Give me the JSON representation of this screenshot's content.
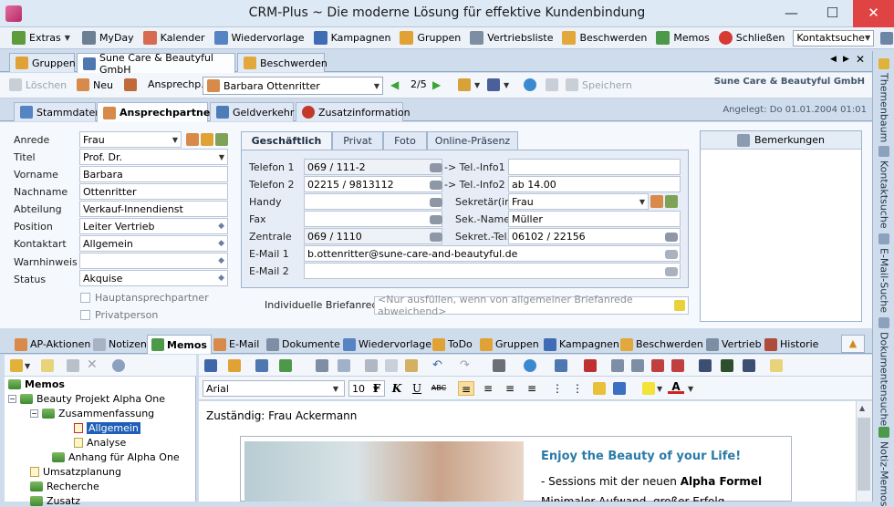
{
  "window": {
    "title": "CRM-Plus ~ Die moderne Lösung für effektive Kundenbindung"
  },
  "menu": {
    "items": [
      "Extras",
      "MyDay",
      "Kalender",
      "Wiedervorlage",
      "Kampagnen",
      "Gruppen",
      "Vertriebsliste",
      "Beschwerden",
      "Memos",
      "Schließen"
    ],
    "search_label": "Kontaktsuche"
  },
  "doc_tabs": [
    "Gruppen",
    "Sune Care & Beautyful GmbH",
    "Beschwerden"
  ],
  "toolbar": {
    "loeschen": "Löschen",
    "neu": "Neu",
    "ansprechp_label": "Ansprechp.:",
    "person": "Barbara Ottenritter",
    "pager": "2/5",
    "speichern": "Speichern",
    "company": "Sune Care & Beautyful GmbH"
  },
  "main_tabs": [
    "Stammdaten",
    "Ansprechpartner",
    "Geldverkehr",
    "Zusatzinformation"
  ],
  "angelegt": "Angelegt:  Do 01.01.2004 01:01",
  "form": {
    "anrede_label": "Anrede",
    "anrede": "Frau",
    "titel_label": "Titel",
    "titel": "Prof. Dr.",
    "vorname_label": "Vorname",
    "vorname": "Barbara",
    "nachname_label": "Nachname",
    "nachname": "Ottenritter",
    "abteilung_label": "Abteilung",
    "abteilung": "Verkauf-Innendienst",
    "position_label": "Position",
    "position": "Leiter Vertrieb",
    "kontaktart_label": "Kontaktart",
    "kontaktart": "Allgemein",
    "warnhinweis_label": "Warnhinweis",
    "warnhinweis": "",
    "status_label": "Status",
    "status": "Akquise",
    "haupt": "Hauptansprechpartner",
    "privat": "Privatperson"
  },
  "phone_tabs": [
    "Geschäftlich",
    "Privat",
    "Foto",
    "Online-Präsenz"
  ],
  "phone": {
    "tel1_label": "Telefon 1",
    "tel1": "069 / 111-2",
    "tel2_label": "Telefon 2",
    "tel2": "02215 / 9813112",
    "handy_label": "Handy",
    "handy": "",
    "fax_label": "Fax",
    "fax": "",
    "zentrale_label": "Zentrale",
    "zentrale": "069 / 1110",
    "email1_label": "E-Mail 1",
    "email1": "b.ottenritter@sune-care-and-beautyful.de",
    "email2_label": "E-Mail 2",
    "email2": "",
    "info1_label": "-> Tel.-Info1",
    "info1": "",
    "info2_label": "-> Tel.-Info2",
    "info2": "ab 14.00",
    "sekretaer_label": "Sekretär(in)",
    "sekretaer": "Frau",
    "seknamen_label": "Sek.-Name",
    "seknamen": "Müller",
    "sektel_label": "Sekret.-Tel.",
    "sektel": "06102 / 22156"
  },
  "briefanrede": {
    "label": "Individuelle Briefanrede",
    "placeholder": "<Nur ausfüllen, wenn von allgemeiner Briefanrede abweichend>"
  },
  "bemerkungen": "Bemerkungen",
  "lower_tabs": [
    "AP-Aktionen",
    "Notizen",
    "Memos",
    "E-Mail",
    "Dokumente",
    "Wiedervorlage",
    "ToDo",
    "Gruppen",
    "Kampagnen",
    "Beschwerden",
    "Vertrieb",
    "Historie"
  ],
  "tree": {
    "root": "Memos",
    "n1": "Beauty Projekt Alpha One",
    "n2": "Zusammenfassung",
    "n3": "Allgemein",
    "n4": "Analyse",
    "n5": "Anhang für Alpha One",
    "n6": "Umsatzplanung",
    "n7": "Recherche",
    "n8": "Zusatz"
  },
  "editor": {
    "font": "Arial",
    "size": "10",
    "zustaendig": "Zuständig: Frau Ackermann",
    "headline": "Enjoy the Beauty of your Life!",
    "bullet1_prefix": "- Sessions mit der neuen ",
    "bullet1_bold": "Alpha Formel",
    "bullet2": "Minimaler Aufwand, großer Erfolg"
  },
  "sidebar": [
    "Themenbaum",
    "Kontaktsuche",
    "E-Mail-Suche",
    "Dokumentensuche",
    "Notiz-Memos"
  ]
}
